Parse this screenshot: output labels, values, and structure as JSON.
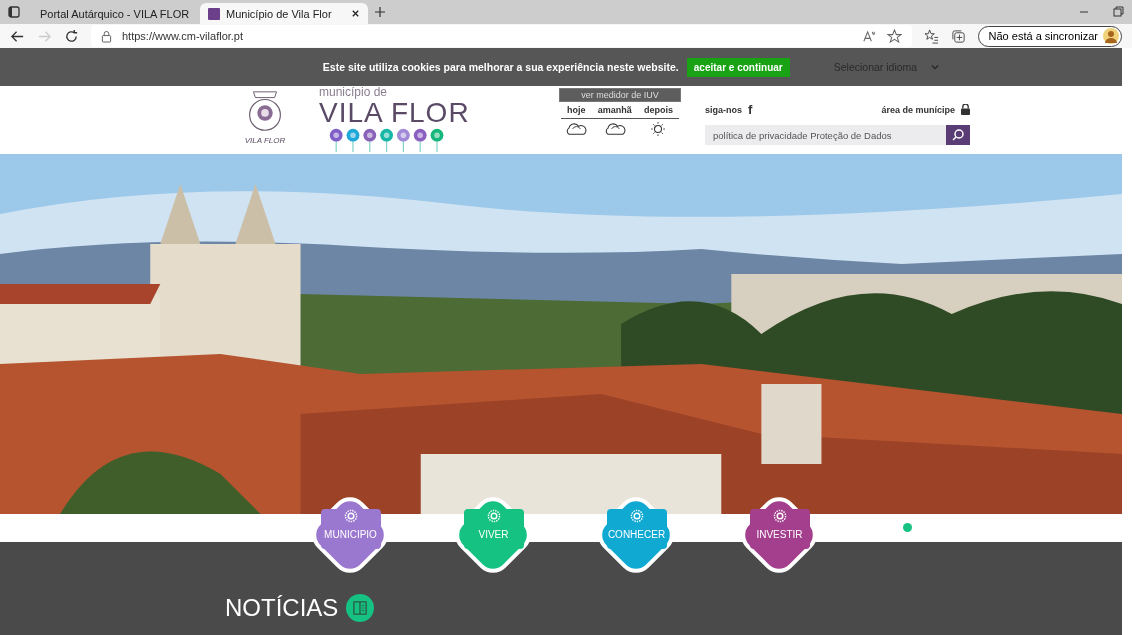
{
  "browser": {
    "tabs": [
      {
        "title": "Portal Autárquico - VILA FLOR",
        "selected": false
      },
      {
        "title": "Município de Vila Flor",
        "selected": true
      }
    ],
    "url": "https://www.cm-vilaflor.pt",
    "sync_label": "Não está a sincronizar"
  },
  "cookie_bar": {
    "text": "Este site utiliza cookies para melhorar a sua experiência neste website.",
    "button": "aceitar e continuar"
  },
  "header": {
    "crest_label": "VILA FLOR",
    "logo_sub": "município de",
    "logo_title": "VILA FLOR",
    "uv_button": "ver medidor de IUV",
    "language": "Selecionar idioma",
    "weather": [
      {
        "day": "hoje",
        "kind": "cloud"
      },
      {
        "day": "amanhã",
        "kind": "cloud"
      },
      {
        "day": "depois",
        "kind": "sun"
      }
    ],
    "social_label": "siga-nos",
    "social_icon": "f",
    "area_label": "área de munícipe",
    "search_placeholder": "política de privacidade Proteção de Dados"
  },
  "nav": [
    {
      "label": "MUNICIPIO",
      "color": "#9b78cf"
    },
    {
      "label": "VIVER",
      "color": "#16c282"
    },
    {
      "label": "CONHECER",
      "color": "#0fa9d2"
    },
    {
      "label": "INVESTIR",
      "color": "#a43f8e"
    }
  ],
  "slider_dots": [
    {
      "selected": true
    }
  ],
  "news": {
    "title": "NOTÍCIAS"
  }
}
